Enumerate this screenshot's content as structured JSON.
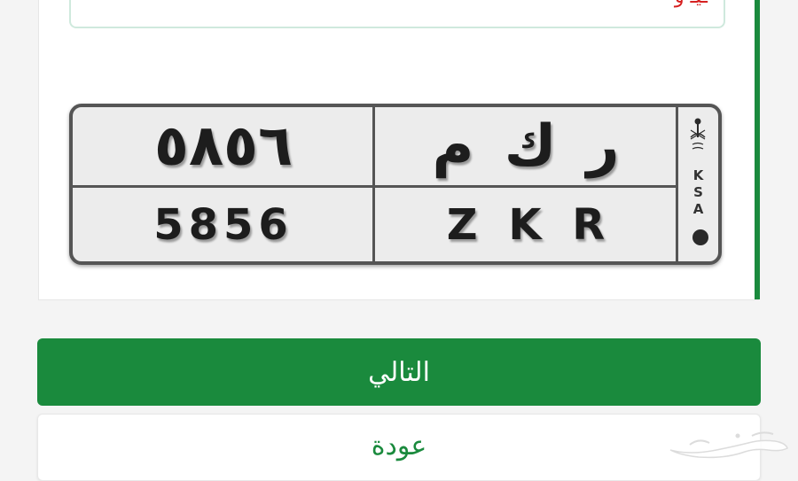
{
  "alert": {
    "text": "ـيـ و"
  },
  "plate": {
    "arabic_digits": "٥٨٥٦",
    "arabic_letters": "ر ك م",
    "english_digits": "5856",
    "english_letters": "Z K R",
    "country_letters": [
      "K",
      "S",
      "A"
    ],
    "emblem_icon": "saudi-emblem-icon"
  },
  "buttons": {
    "next_label": "التالي",
    "back_label": "عودة"
  },
  "colors": {
    "accent": "#1a8a3d",
    "alert": "#d61f1f",
    "plate_border": "#555555",
    "plate_bg": "#ececec"
  },
  "watermark": {
    "icon": "haraj-logo-watermark"
  }
}
